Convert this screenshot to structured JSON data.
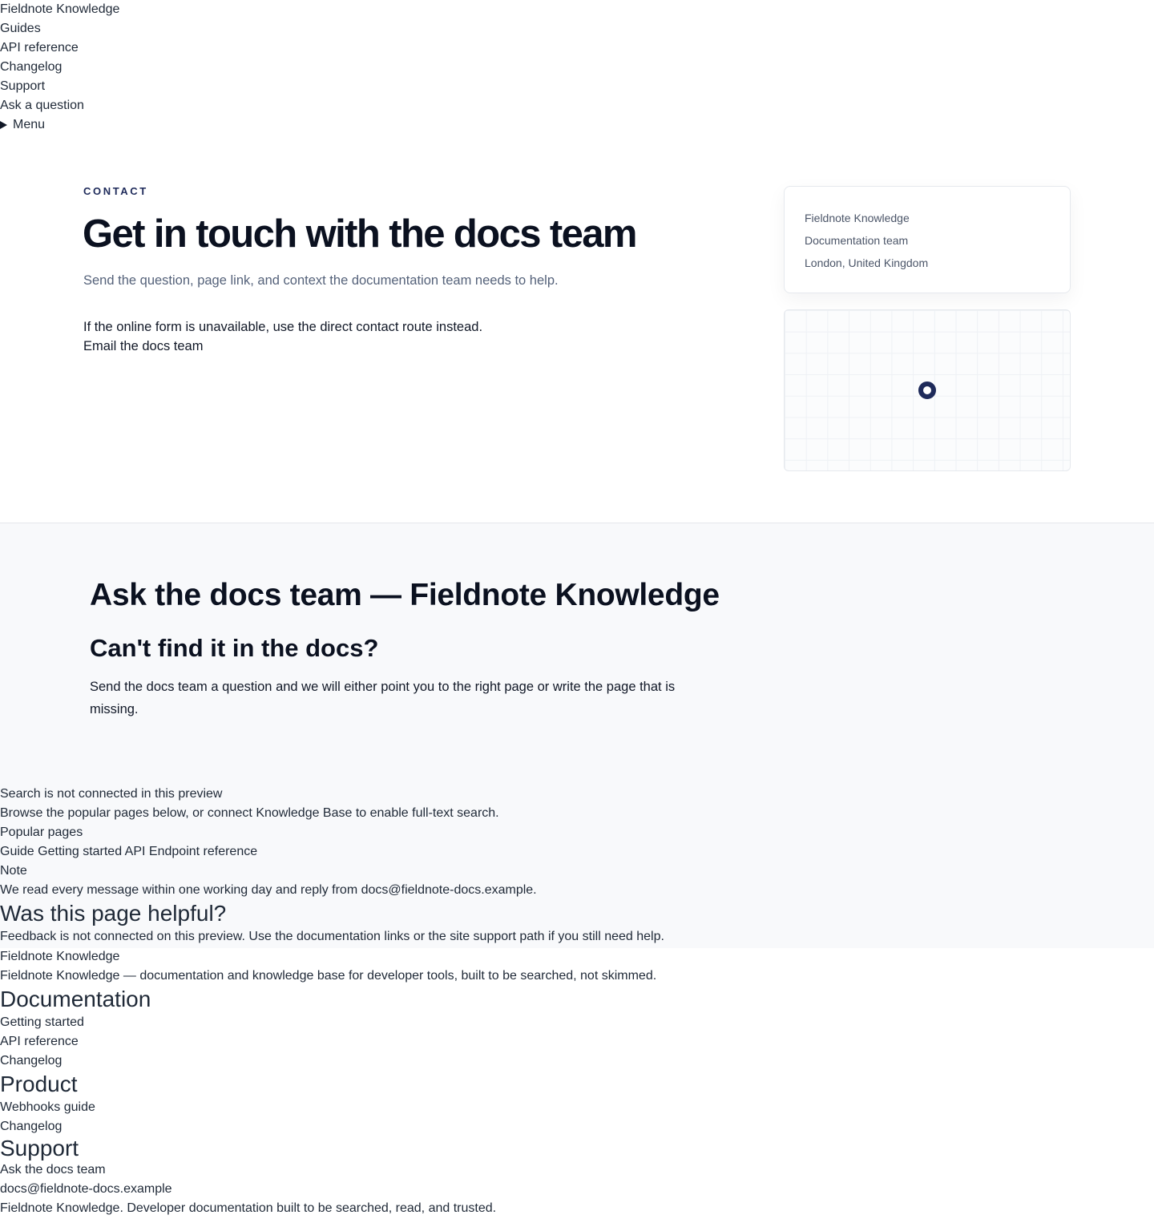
{
  "nav": {
    "brand": "Fieldnote Knowledge",
    "links": [
      "Guides",
      "API reference",
      "Changelog",
      "Support",
      "Ask a question"
    ],
    "menu_label": "Menu"
  },
  "hero": {
    "eyebrow": "CONTACT",
    "title": "Get in touch with the docs team",
    "subtitle": "Send the question, page link, and context the documentation team needs to help.",
    "fallback_text": "If the online form is unavailable, use the direct contact route instead.",
    "email_link": "Email the docs team"
  },
  "address": {
    "lines": [
      "Fieldnote Knowledge",
      "Documentation team",
      "London, United Kingdom"
    ]
  },
  "ask": {
    "title": "Ask the docs team — Fieldnote Knowledge",
    "heading": "Can't find it in the docs?",
    "body": "Send the docs team a question and we will either point you to the right page or write the page that is missing."
  },
  "search": {
    "status": "Search is not connected in this preview",
    "hint": "Browse the popular pages below, or connect Knowledge Base to enable full-text search.",
    "popular_label": "Popular pages",
    "popular_items": [
      {
        "tag": "Guide",
        "label": "Getting started"
      },
      {
        "tag": "API",
        "label": "Endpoint reference"
      }
    ]
  },
  "note": {
    "label": "Note",
    "text": "We read every message within one working day and reply from docs@fieldnote-docs.example."
  },
  "feedback": {
    "title": "Was this page helpful?",
    "text": "Feedback is not connected on this preview. Use the documentation links or the site support path if you still need help."
  },
  "footer": {
    "brand": "Fieldnote Knowledge",
    "tagline": "Fieldnote Knowledge — documentation and knowledge base for developer tools, built to be searched, not skimmed.",
    "columns": [
      {
        "title": "Documentation",
        "links": [
          "Getting started",
          "API reference",
          "Changelog"
        ]
      },
      {
        "title": "Product",
        "links": [
          "Webhooks guide",
          "Changelog"
        ]
      },
      {
        "title": "Support",
        "links": [
          "Ask the docs team",
          "docs@fieldnote-docs.example"
        ]
      }
    ],
    "legal": "Fieldnote Knowledge. Developer documentation built to be searched, read, and trusted."
  }
}
